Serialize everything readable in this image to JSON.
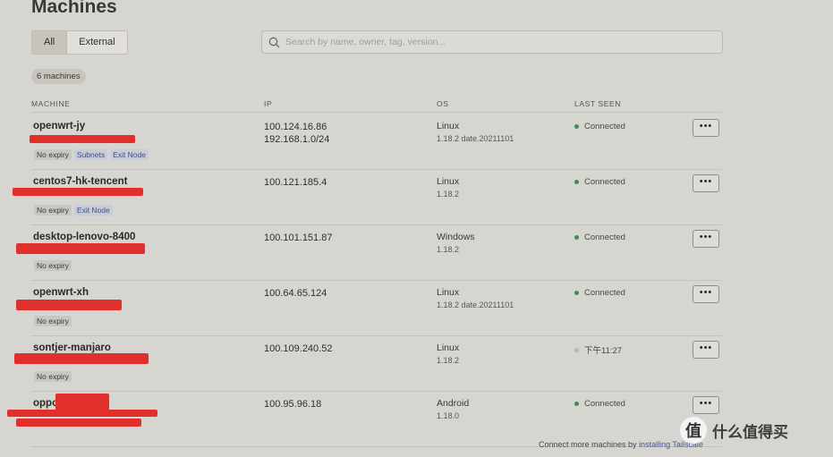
{
  "page": {
    "title": "Machines"
  },
  "filters": {
    "tabs": [
      "All",
      "External"
    ],
    "active": "All"
  },
  "search": {
    "placeholder": "Search by name, owner, tag, version..."
  },
  "summary": {
    "count_label": "6 machines"
  },
  "table": {
    "headers": {
      "machine": "MACHINE",
      "ip": "IP",
      "os": "OS",
      "last_seen": "LAST SEEN"
    },
    "rows": [
      {
        "name": "openwrt-jy",
        "ip1": "100.124.16.86",
        "ip2": "192.168.1.0/24",
        "os": "Linux",
        "os_version": "1.18.2  date.20211101",
        "tags": [
          "No expiry",
          "Subnets",
          "Exit Node"
        ],
        "status": "Connected",
        "connected": true
      },
      {
        "name": "centos7-hk-tencent",
        "ip1": "100.121.185.4",
        "ip2": "",
        "os": "Linux",
        "os_version": "1.18.2",
        "tags": [
          "No expiry",
          "Exit Node"
        ],
        "status": "Connected",
        "connected": true
      },
      {
        "name": "desktop-lenovo-8400",
        "ip1": "100.101.151.87",
        "ip2": "",
        "os": "Windows",
        "os_version": "1.18.2",
        "tags": [
          "No expiry"
        ],
        "status": "Connected",
        "connected": true
      },
      {
        "name": "openwrt-xh",
        "ip1": "100.64.65.124",
        "ip2": "",
        "os": "Linux",
        "os_version": "1.18.2  date.20211101",
        "tags": [
          "No expiry"
        ],
        "status": "Connected",
        "connected": true
      },
      {
        "name": "sontjer-manjaro",
        "ip1": "100.109.240.52",
        "ip2": "",
        "os": "Linux",
        "os_version": "1.18.2",
        "tags": [
          "No expiry"
        ],
        "status": "下午11:27",
        "connected": false
      },
      {
        "name": "oppo",
        "ip1": "100.95.96.18",
        "ip2": "",
        "os": "Android",
        "os_version": "1.18.0",
        "tags": [],
        "status": "Connected",
        "connected": true
      }
    ],
    "menu_label": "•••"
  },
  "footer": {
    "text": "Connect more machines by ",
    "link": "installing Tailscale"
  },
  "watermark": {
    "text": "什么值得买",
    "logo": "值"
  },
  "colors": {
    "connected": "#3f8f55",
    "idle": "#bab8b2",
    "redaction": "#e1302c",
    "tag_blue": "#3d4f8a"
  },
  "icons": {
    "search": "search-icon",
    "menu": "more-horizontal-icon"
  }
}
